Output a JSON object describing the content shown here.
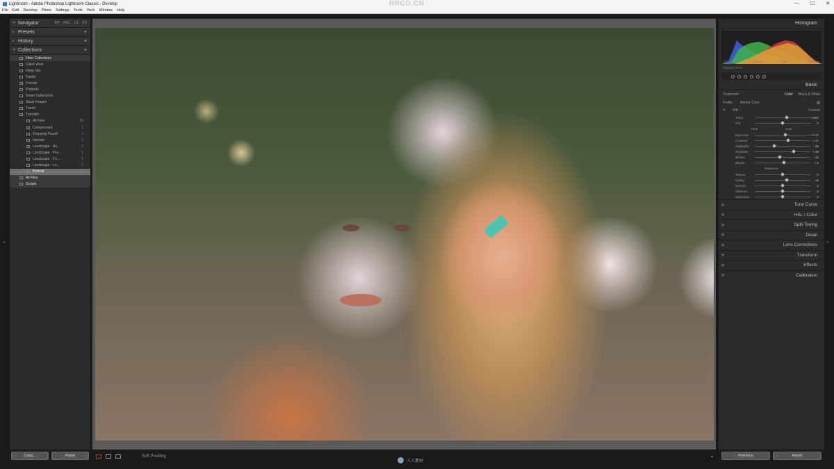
{
  "titlebar": {
    "title": "Lightroom - Adobe Photoshop Lightroom Classic - Develop",
    "watermark": "RRCG.CN",
    "min": "—",
    "max": "☐",
    "close": "✕"
  },
  "menubar": {
    "items": [
      "File",
      "Edit",
      "Develop",
      "Photo",
      "Settings",
      "Tools",
      "View",
      "Window",
      "Help"
    ]
  },
  "left": {
    "navigator": {
      "label": "Navigator",
      "zoom": [
        "FIT",
        "FILL",
        "1:1",
        "3:1"
      ]
    },
    "presets": "Presets",
    "history": "History",
    "collections": "Collections",
    "rows": [
      {
        "label": "Filter Collections",
        "count": "",
        "type": "grp"
      },
      {
        "label": "Client Work",
        "count": "",
        "type": "row"
      },
      {
        "label": "Deep Sky",
        "count": "",
        "type": "row"
      },
      {
        "label": "Family",
        "count": "",
        "type": "row"
      },
      {
        "label": "Friends",
        "count": "",
        "type": "row"
      },
      {
        "label": "Portraits",
        "count": "",
        "type": "row"
      },
      {
        "label": "Smart Collections",
        "count": "",
        "type": "row"
      },
      {
        "label": "Stock Images",
        "count": "",
        "type": "row"
      },
      {
        "label": "Travel",
        "count": "",
        "type": "row"
      },
      {
        "label": "Tutorials",
        "count": "",
        "type": "row"
      },
      {
        "label": "All Files",
        "count": "20",
        "type": "sub"
      },
      {
        "label": "Compressed",
        "count": "1",
        "type": "sub"
      },
      {
        "label": "Dropping Pound",
        "count": "1",
        "type": "sub"
      },
      {
        "label": "Interact",
        "count": "1",
        "type": "sub"
      },
      {
        "label": "Landscape - Re...",
        "count": "1",
        "type": "sub"
      },
      {
        "label": "Landscape - Pro...",
        "count": "1",
        "type": "sub"
      },
      {
        "label": "Landscape - F1...",
        "count": "1",
        "type": "sub"
      },
      {
        "label": "Landscape - Lo...",
        "count": "1",
        "type": "sub"
      },
      {
        "label": "Portrait",
        "count": "2",
        "type": "sel"
      },
      {
        "label": "All Files",
        "count": "",
        "type": "grp"
      },
      {
        "label": "Scripts",
        "count": "",
        "type": "grp"
      }
    ],
    "copy_btn": "Copy...",
    "paste_btn": "Paste"
  },
  "toolbar": {
    "soft_proofing": "Soft Proofing"
  },
  "bottom_logo": "人人素材",
  "right": {
    "histogram_label": "Histogram",
    "hist_values": [
      "ISO 100",
      "85 mm",
      "f/1.4",
      "1/500 sec"
    ],
    "original_photo": "Original Photo",
    "basic_label": "Basic",
    "treatment": {
      "label": "Treatment :",
      "color": "Color",
      "bw": "Black & White"
    },
    "profile": {
      "label": "Profile :",
      "value": "Adobe Color"
    },
    "wb": {
      "label": "WB :",
      "value": "Custom"
    },
    "sliders_wb": [
      {
        "label": "Temp",
        "value": "4,850",
        "pos": 0.58
      },
      {
        "label": "Tint",
        "value": "0",
        "pos": 0.5
      }
    ],
    "tone_title": "Tone",
    "tone_auto": "Auto",
    "sliders_tone": [
      {
        "label": "Exposure",
        "value": "+ 0.17",
        "pos": 0.55
      },
      {
        "label": "Contrast",
        "value": "+ 17",
        "pos": 0.6
      },
      {
        "label": "Highlights",
        "value": "- 36",
        "pos": 0.35
      },
      {
        "label": "Shadows",
        "value": "+ 38",
        "pos": 0.7
      },
      {
        "label": "Whites",
        "value": "- 11",
        "pos": 0.45
      },
      {
        "label": "Blacks",
        "value": "+ 6",
        "pos": 0.53
      }
    ],
    "presence_title": "Presence",
    "sliders_presence": [
      {
        "label": "Texture",
        "value": "0",
        "pos": 0.5
      },
      {
        "label": "Clarity",
        "value": "16",
        "pos": 0.58
      },
      {
        "label": "Dehaze",
        "value": "0",
        "pos": 0.5
      },
      {
        "label": "Vibrance",
        "value": "0",
        "pos": 0.5
      },
      {
        "label": "Saturation",
        "value": "0",
        "pos": 0.5
      }
    ],
    "sections": [
      "Tone Curve",
      "HSL / Color",
      "Split Toning",
      "Detail",
      "Lens Corrections",
      "Transform",
      "Effects",
      "Calibration"
    ],
    "previous_btn": "Previous",
    "reset_btn": "Reset"
  }
}
